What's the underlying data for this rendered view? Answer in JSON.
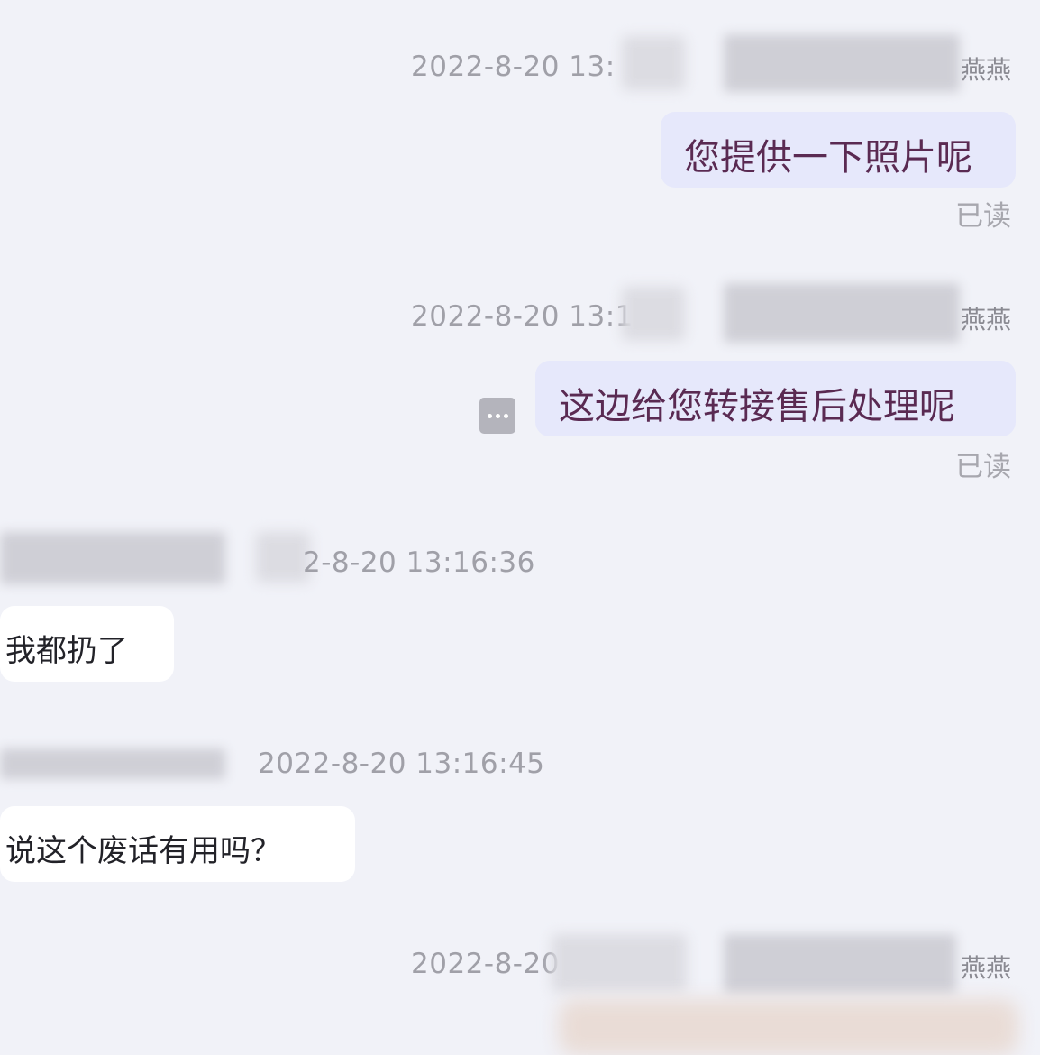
{
  "messages": [
    {
      "direction": "outgoing",
      "timestamp": "2022-8-20 13:",
      "sender_suffix": "燕燕",
      "text": "您提供一下照片呢",
      "status": "已读"
    },
    {
      "direction": "outgoing",
      "timestamp": "2022-8-20 13:1",
      "sender_suffix": "燕燕",
      "text": "这边给您转接售后处理呢",
      "status": "已读",
      "action_icon": "more-icon"
    },
    {
      "direction": "incoming",
      "timestamp": "2-8-20 13:16:36",
      "text": "我都扔了"
    },
    {
      "direction": "incoming",
      "timestamp": "2022-8-20 13:16:45",
      "text": "说这个废话有用吗？"
    },
    {
      "direction": "outgoing",
      "timestamp": "2022-8-20",
      "sender_suffix": "燕燕"
    }
  ],
  "colors": {
    "background": "#f1f2f8",
    "outgoing_bubble": "#e6e8fb",
    "outgoing_text": "#5a2a52",
    "incoming_bubble": "#ffffff",
    "timestamp": "#a0a0a8"
  }
}
